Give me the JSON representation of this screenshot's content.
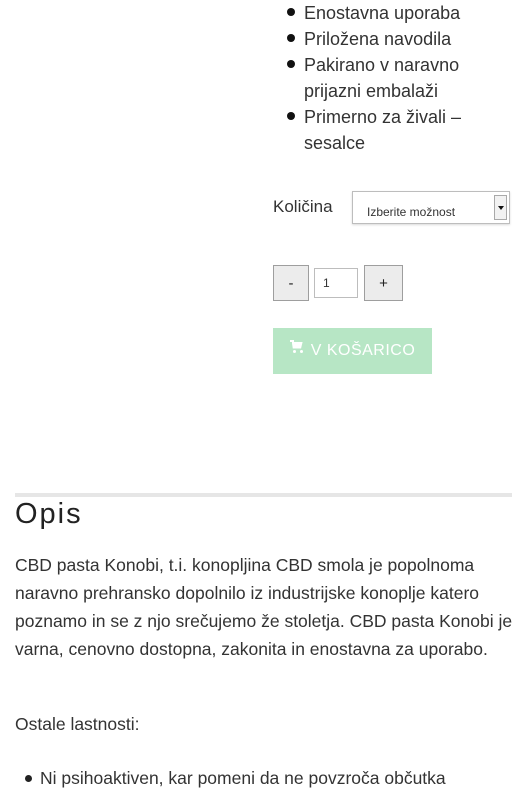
{
  "features": [
    "Enostavna uporaba",
    "Priložena navodila",
    "Pakirano v naravno prijazni embalaži",
    "Primerno za živali – sesalce"
  ],
  "quantity": {
    "label": "Količina",
    "select_value": "Izberite možnost",
    "minus_label": "-",
    "plus_label": "+",
    "value": "1"
  },
  "cart": {
    "label": "V KOŠARICO",
    "icon": "shopping-cart-icon",
    "color": "#b7e6c5"
  },
  "description": {
    "heading": "Opis",
    "text": "CBD pasta Konobi, t.i. konopljina CBD smola je popolnoma naravno prehransko dopolnilo iz industrijske konoplje katero poznamo in se z njo srečujemo že stoletja. CBD pasta Konobi je varna, cenovno dostopna, zakonita in enostavna za uporabo.",
    "other_label": "Ostale lastnosti:",
    "bullets": [
      "Ni psihoaktiven, kar pomeni da ne povzroča občutka"
    ]
  }
}
